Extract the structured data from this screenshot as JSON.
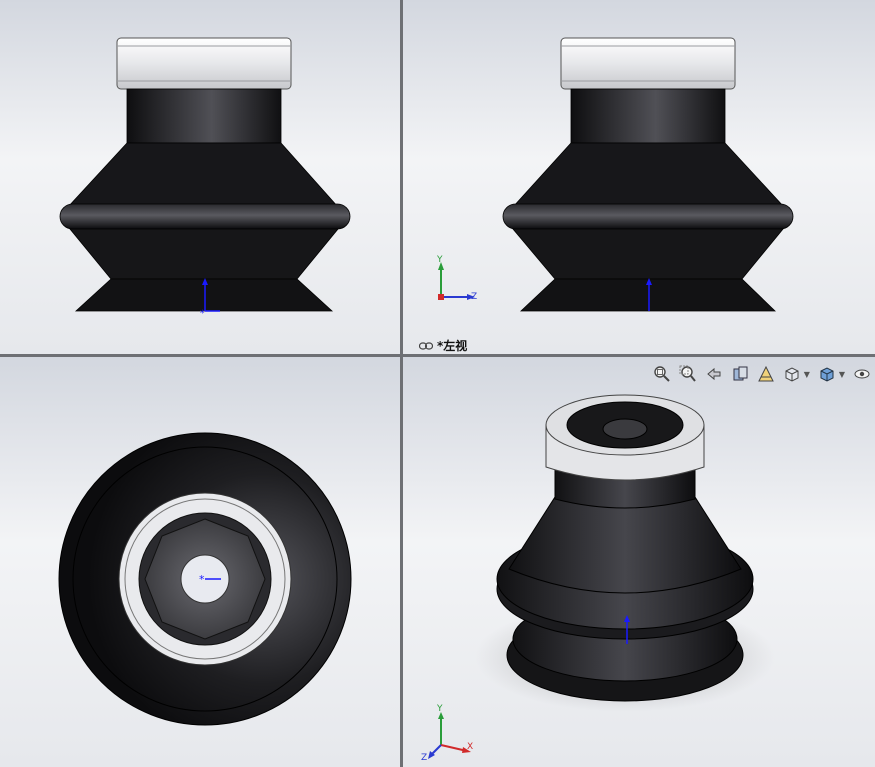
{
  "viewports": {
    "top_right": {
      "view_label": "*左视"
    }
  },
  "triad": {
    "y_label": "Y",
    "z_label": "Z",
    "x_label": "X"
  },
  "heads_up_toolbar": {
    "icons": [
      "zoom-to-fit-icon",
      "zoom-to-area-icon",
      "previous-view-icon",
      "section-view-icon",
      "dynamic-annotation-view-icon",
      "view-orientation-icon",
      "display-style-icon",
      "hide-show-items-icon"
    ]
  },
  "colors": {
    "rubber": "#1a1a1c",
    "metal_band": "#e8e9ec",
    "axis_y": "#2a9d3a",
    "axis_z": "#2a3ad1",
    "axis_x": "#d12a2a",
    "origin": "#1a1aff"
  }
}
